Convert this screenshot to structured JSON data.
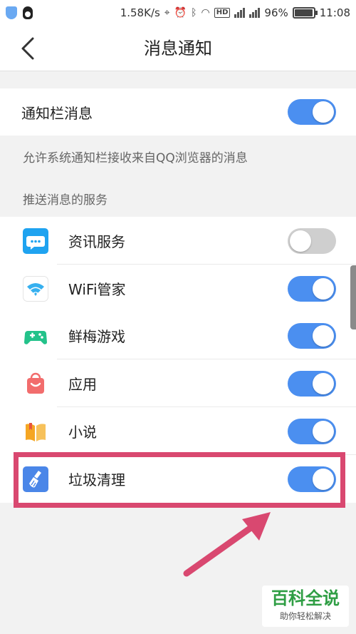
{
  "status_bar": {
    "speed": "1.58K/s",
    "hd_label": "HD",
    "battery_percent": 96,
    "battery_text": "96%",
    "time": "11:08"
  },
  "header": {
    "title": "消息通知"
  },
  "notification_bar": {
    "label": "通知栏消息",
    "enabled": true
  },
  "permission_note": "允许系统通知栏接收来自QQ浏览器的消息",
  "services_section": {
    "heading": "推送消息的服务",
    "items": [
      {
        "label": "资讯服务",
        "icon": "chat-bubble-icon",
        "enabled": false,
        "color": "#1fa3f0"
      },
      {
        "label": "WiFi管家",
        "icon": "wifi-icon",
        "enabled": true,
        "color": "#36b0ef"
      },
      {
        "label": "鲜梅游戏",
        "icon": "gamepad-icon",
        "enabled": true,
        "color": "#23c28a"
      },
      {
        "label": "应用",
        "icon": "shopping-bag-icon",
        "enabled": true,
        "color": "#f26d6d"
      },
      {
        "label": "小说",
        "icon": "book-icon",
        "enabled": true,
        "color": "#f5a623"
      },
      {
        "label": "垃圾清理",
        "icon": "broom-icon",
        "enabled": true,
        "color": "#4a86e8"
      }
    ]
  },
  "watermark": {
    "main": "百科全说",
    "sub": "助你轻松解决"
  },
  "colors": {
    "toggle_on": "#4b8ff0",
    "toggle_off": "#cfcfcf",
    "highlight": "#d94870",
    "background": "#f2f2f2"
  }
}
